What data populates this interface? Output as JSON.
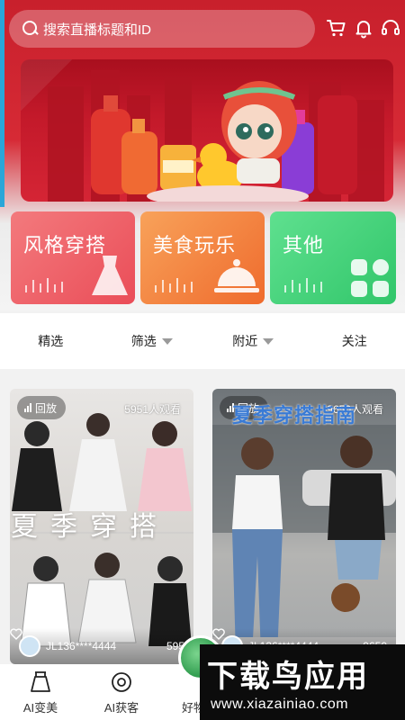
{
  "search": {
    "placeholder": "搜索直播标题和ID"
  },
  "header_icons": [
    "cart-icon",
    "bell-icon",
    "headset-icon"
  ],
  "categories": [
    {
      "label": "风格穿搭",
      "color": "#ea4d58"
    },
    {
      "label": "美食玩乐",
      "color": "#ef6b2d"
    },
    {
      "label": "其他",
      "color": "#31c66a"
    }
  ],
  "filters": [
    {
      "label": "精选",
      "dropdown": false
    },
    {
      "label": "筛选",
      "dropdown": true
    },
    {
      "label": "附近",
      "dropdown": true
    },
    {
      "label": "关注",
      "dropdown": false
    }
  ],
  "videos": [
    {
      "status": "回放",
      "viewers": "5951人观看",
      "overlay_title": "夏季穿搭",
      "user": "JL136****4444",
      "likes": "595"
    },
    {
      "status": "回放",
      "viewers": "9650人观看",
      "overlay_title": "夏季穿搭指南",
      "user": "JL136****4444",
      "likes": "9650"
    }
  ],
  "bottom_nav": [
    {
      "label": "AI变美",
      "icon": "skirt-icon"
    },
    {
      "label": "AI获客",
      "icon": "target-icon"
    },
    {
      "label": "好物",
      "icon": "bag-icon"
    }
  ],
  "watermark": {
    "brand": "下载鸟应用",
    "url": "www.xiazainiao.com"
  },
  "colors": {
    "brand_red": "#d62a35",
    "card_style": "#ea4d58",
    "card_food": "#ef6b2d",
    "card_other": "#31c66a"
  }
}
